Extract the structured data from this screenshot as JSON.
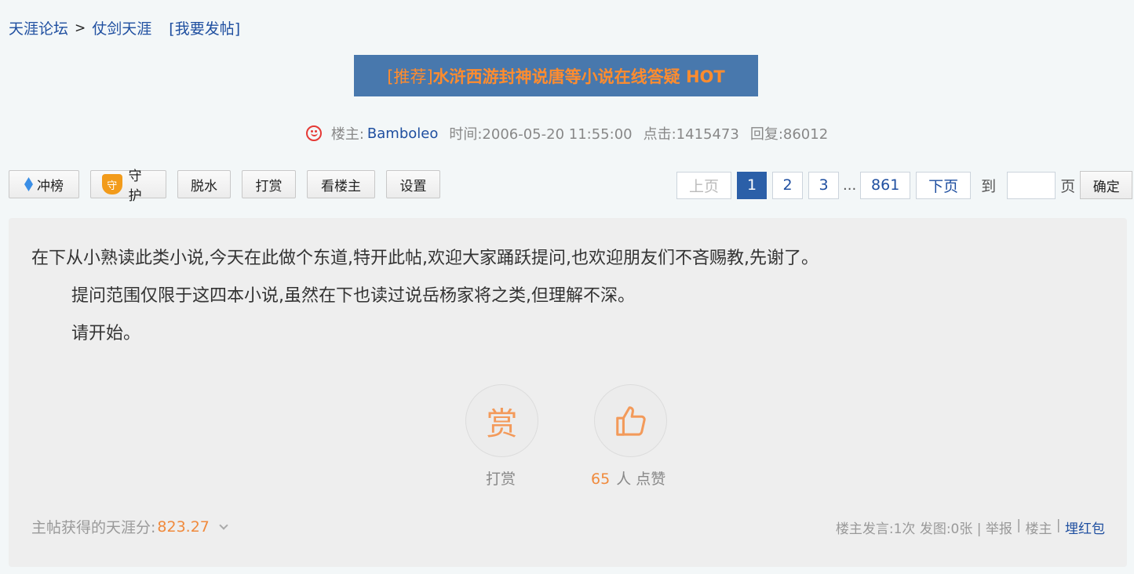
{
  "breadcrumb": {
    "forum": "天涯论坛",
    "separator": ">",
    "board": "仗剑天涯",
    "new_post": "[我要发帖]"
  },
  "title": {
    "tag": "[推荐]",
    "text": "水浒西游封神说唐等小说在线答疑 HOT"
  },
  "meta": {
    "author_label": "楼主:",
    "author": "Bamboleo",
    "time": "时间:2006-05-20 11:55:00",
    "clicks": "点击:1415473",
    "replies": "回复:86012",
    "icon": "smile-icon",
    "icon_color": "#e53935"
  },
  "toolbar": {
    "rank": "冲榜",
    "guard_icon_text": "守",
    "guard": "守护",
    "dehydrate": "脱水",
    "reward": "打赏",
    "owner_only": "看楼主",
    "settings": "设置"
  },
  "pager": {
    "prev": "上页",
    "pages": [
      "1",
      "2",
      "3"
    ],
    "ellipsis": "...",
    "last": "861",
    "next": "下页",
    "goto": "到",
    "page_unit": "页",
    "confirm": "确定",
    "current": "1"
  },
  "post": {
    "line1": "在下从小熟读此类小说,今天在此做个东道,特开此帖,欢迎大家踊跃提问,也欢迎朋友们不吝赐教,先谢了。",
    "line2": "提问范围仅限于这四本小说,虽然在下也读过说岳杨家将之类,但理解不深。",
    "line3": "请开始。"
  },
  "actions": {
    "reward_glyph": "赏",
    "reward_label": "打赏",
    "like_count": "65",
    "like_label": "人 点赞"
  },
  "score": {
    "label": "主帖获得的天涯分:",
    "value": "823.27"
  },
  "footer": {
    "owner_posts": "楼主发言:1次 发图:0张 | ",
    "report": " 举报",
    "sep": " | ",
    "owner": "楼主",
    "sep2": " | ",
    "red_packet": "埋红包"
  },
  "colors": {
    "title_bg": "#4878ad",
    "accent_orange": "#ff8c2e",
    "link_blue": "#1f4fa0",
    "current_page_bg": "#2b5fa8"
  }
}
